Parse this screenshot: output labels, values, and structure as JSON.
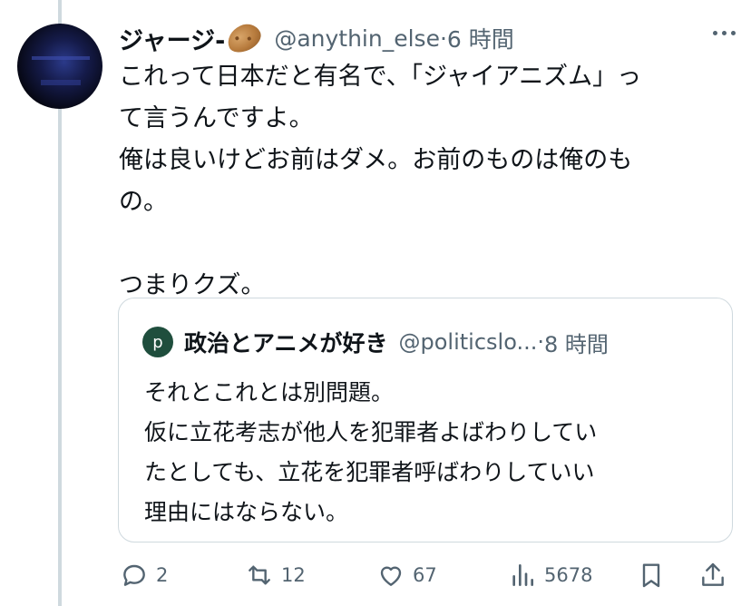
{
  "post": {
    "display_name": "ジャージ-",
    "handle": "@anythin_else",
    "separator": "·",
    "time": "6 時間",
    "text": "これって日本だと有名で、「ジャイアニズム」っ\nて言うんですよ。\n俺は良いけどお前はダメ。お前のものは俺のも\nの。\n\nつまりクズ。"
  },
  "quote": {
    "avatar_letter": "p",
    "display_name": "政治とアニメが好き",
    "handle": "@politicslo...",
    "separator": "·",
    "time": "8 時間",
    "text": "それとこれとは別問題。\n仮に立花考志が他人を犯罪者よばわりしてい\nたとしても、立花を犯罪者呼ばわりしていい\n理由にはならない。"
  },
  "actions": {
    "replies": "2",
    "reposts": "12",
    "likes": "67",
    "views": "5678"
  },
  "colors": {
    "text": "#0f1419",
    "secondary": "#536471",
    "border": "#cfd9de",
    "quote_avatar": "#1f4e3d"
  },
  "icons": [
    "more-icon",
    "potato-emoji",
    "reply-icon",
    "repost-icon",
    "like-icon",
    "views-icon",
    "bookmark-icon",
    "share-icon"
  ]
}
